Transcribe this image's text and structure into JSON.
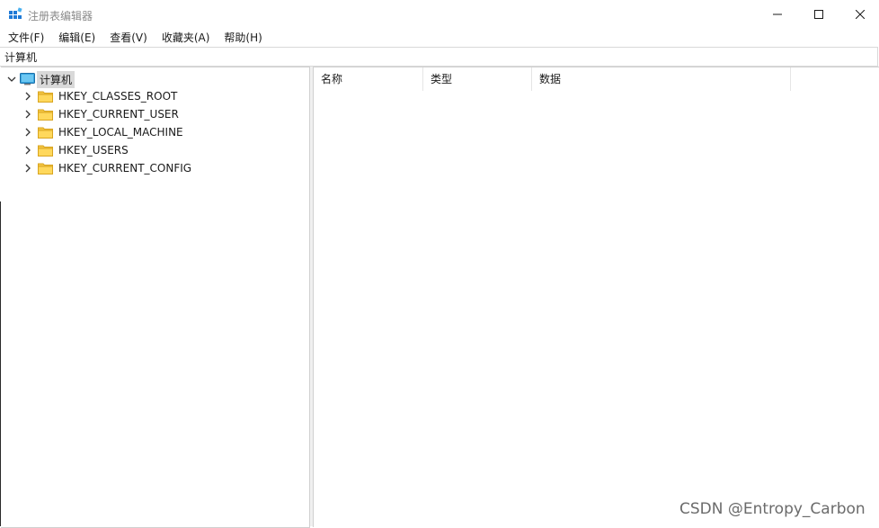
{
  "window": {
    "title": "注册表编辑器",
    "controls": {
      "minimize_icon": "minimize-icon",
      "maximize_icon": "maximize-icon",
      "close_icon": "close-icon"
    }
  },
  "menubar": {
    "items": [
      {
        "label": "文件(F)"
      },
      {
        "label": "编辑(E)"
      },
      {
        "label": "查看(V)"
      },
      {
        "label": "收藏夹(A)"
      },
      {
        "label": "帮助(H)"
      }
    ]
  },
  "address": {
    "path": "计算机"
  },
  "tree": {
    "root": {
      "label": "计算机",
      "expanded": true,
      "selected": true
    },
    "children": [
      {
        "label": "HKEY_CLASSES_ROOT"
      },
      {
        "label": "HKEY_CURRENT_USER"
      },
      {
        "label": "HKEY_LOCAL_MACHINE"
      },
      {
        "label": "HKEY_USERS"
      },
      {
        "label": "HKEY_CURRENT_CONFIG"
      }
    ]
  },
  "list": {
    "columns": [
      {
        "label": "名称"
      },
      {
        "label": "类型"
      },
      {
        "label": "数据"
      }
    ],
    "rows": []
  },
  "watermark": "CSDN @Entropy_Carbon",
  "colors": {
    "folder": "#f4c542",
    "accent": "#0a64c8",
    "selection": "#d9d9d9"
  }
}
